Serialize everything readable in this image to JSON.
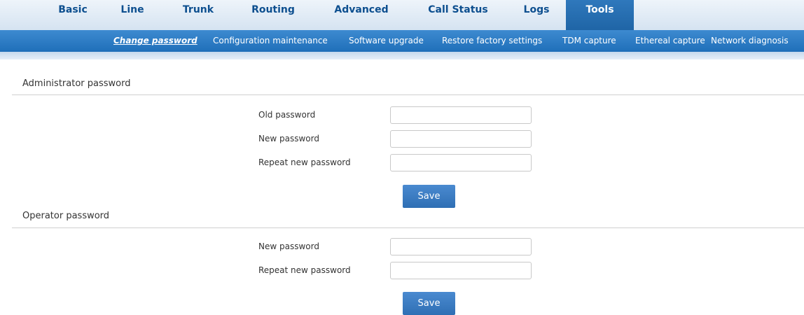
{
  "topnav": {
    "tabs": [
      {
        "label": "Basic"
      },
      {
        "label": "Line"
      },
      {
        "label": "Trunk"
      },
      {
        "label": "Routing"
      },
      {
        "label": "Advanced"
      },
      {
        "label": "Call Status"
      },
      {
        "label": "Logs"
      },
      {
        "label": "Tools",
        "active": true
      }
    ]
  },
  "subnav": {
    "items": [
      {
        "label": "Change password",
        "active": true
      },
      {
        "label": "Configuration maintenance"
      },
      {
        "label": "Software upgrade"
      },
      {
        "label": "Restore factory settings"
      },
      {
        "label": "TDM capture"
      },
      {
        "label": "Ethereal capture"
      },
      {
        "label": "Network diagnosis"
      }
    ]
  },
  "admin": {
    "title": "Administrator password",
    "old_label": "Old password",
    "new_label": "New password",
    "repeat_label": "Repeat new password",
    "old_value": "",
    "new_value": "",
    "repeat_value": "",
    "save_label": "Save"
  },
  "operator": {
    "title": "Operator password",
    "new_label": "New password",
    "repeat_label": "Repeat new password",
    "new_value": "",
    "repeat_value": "",
    "save_label": "Save"
  },
  "colors": {
    "accent": "#2f78bc",
    "nav_text": "#0d4f8f",
    "button": "#3a7ec4"
  }
}
